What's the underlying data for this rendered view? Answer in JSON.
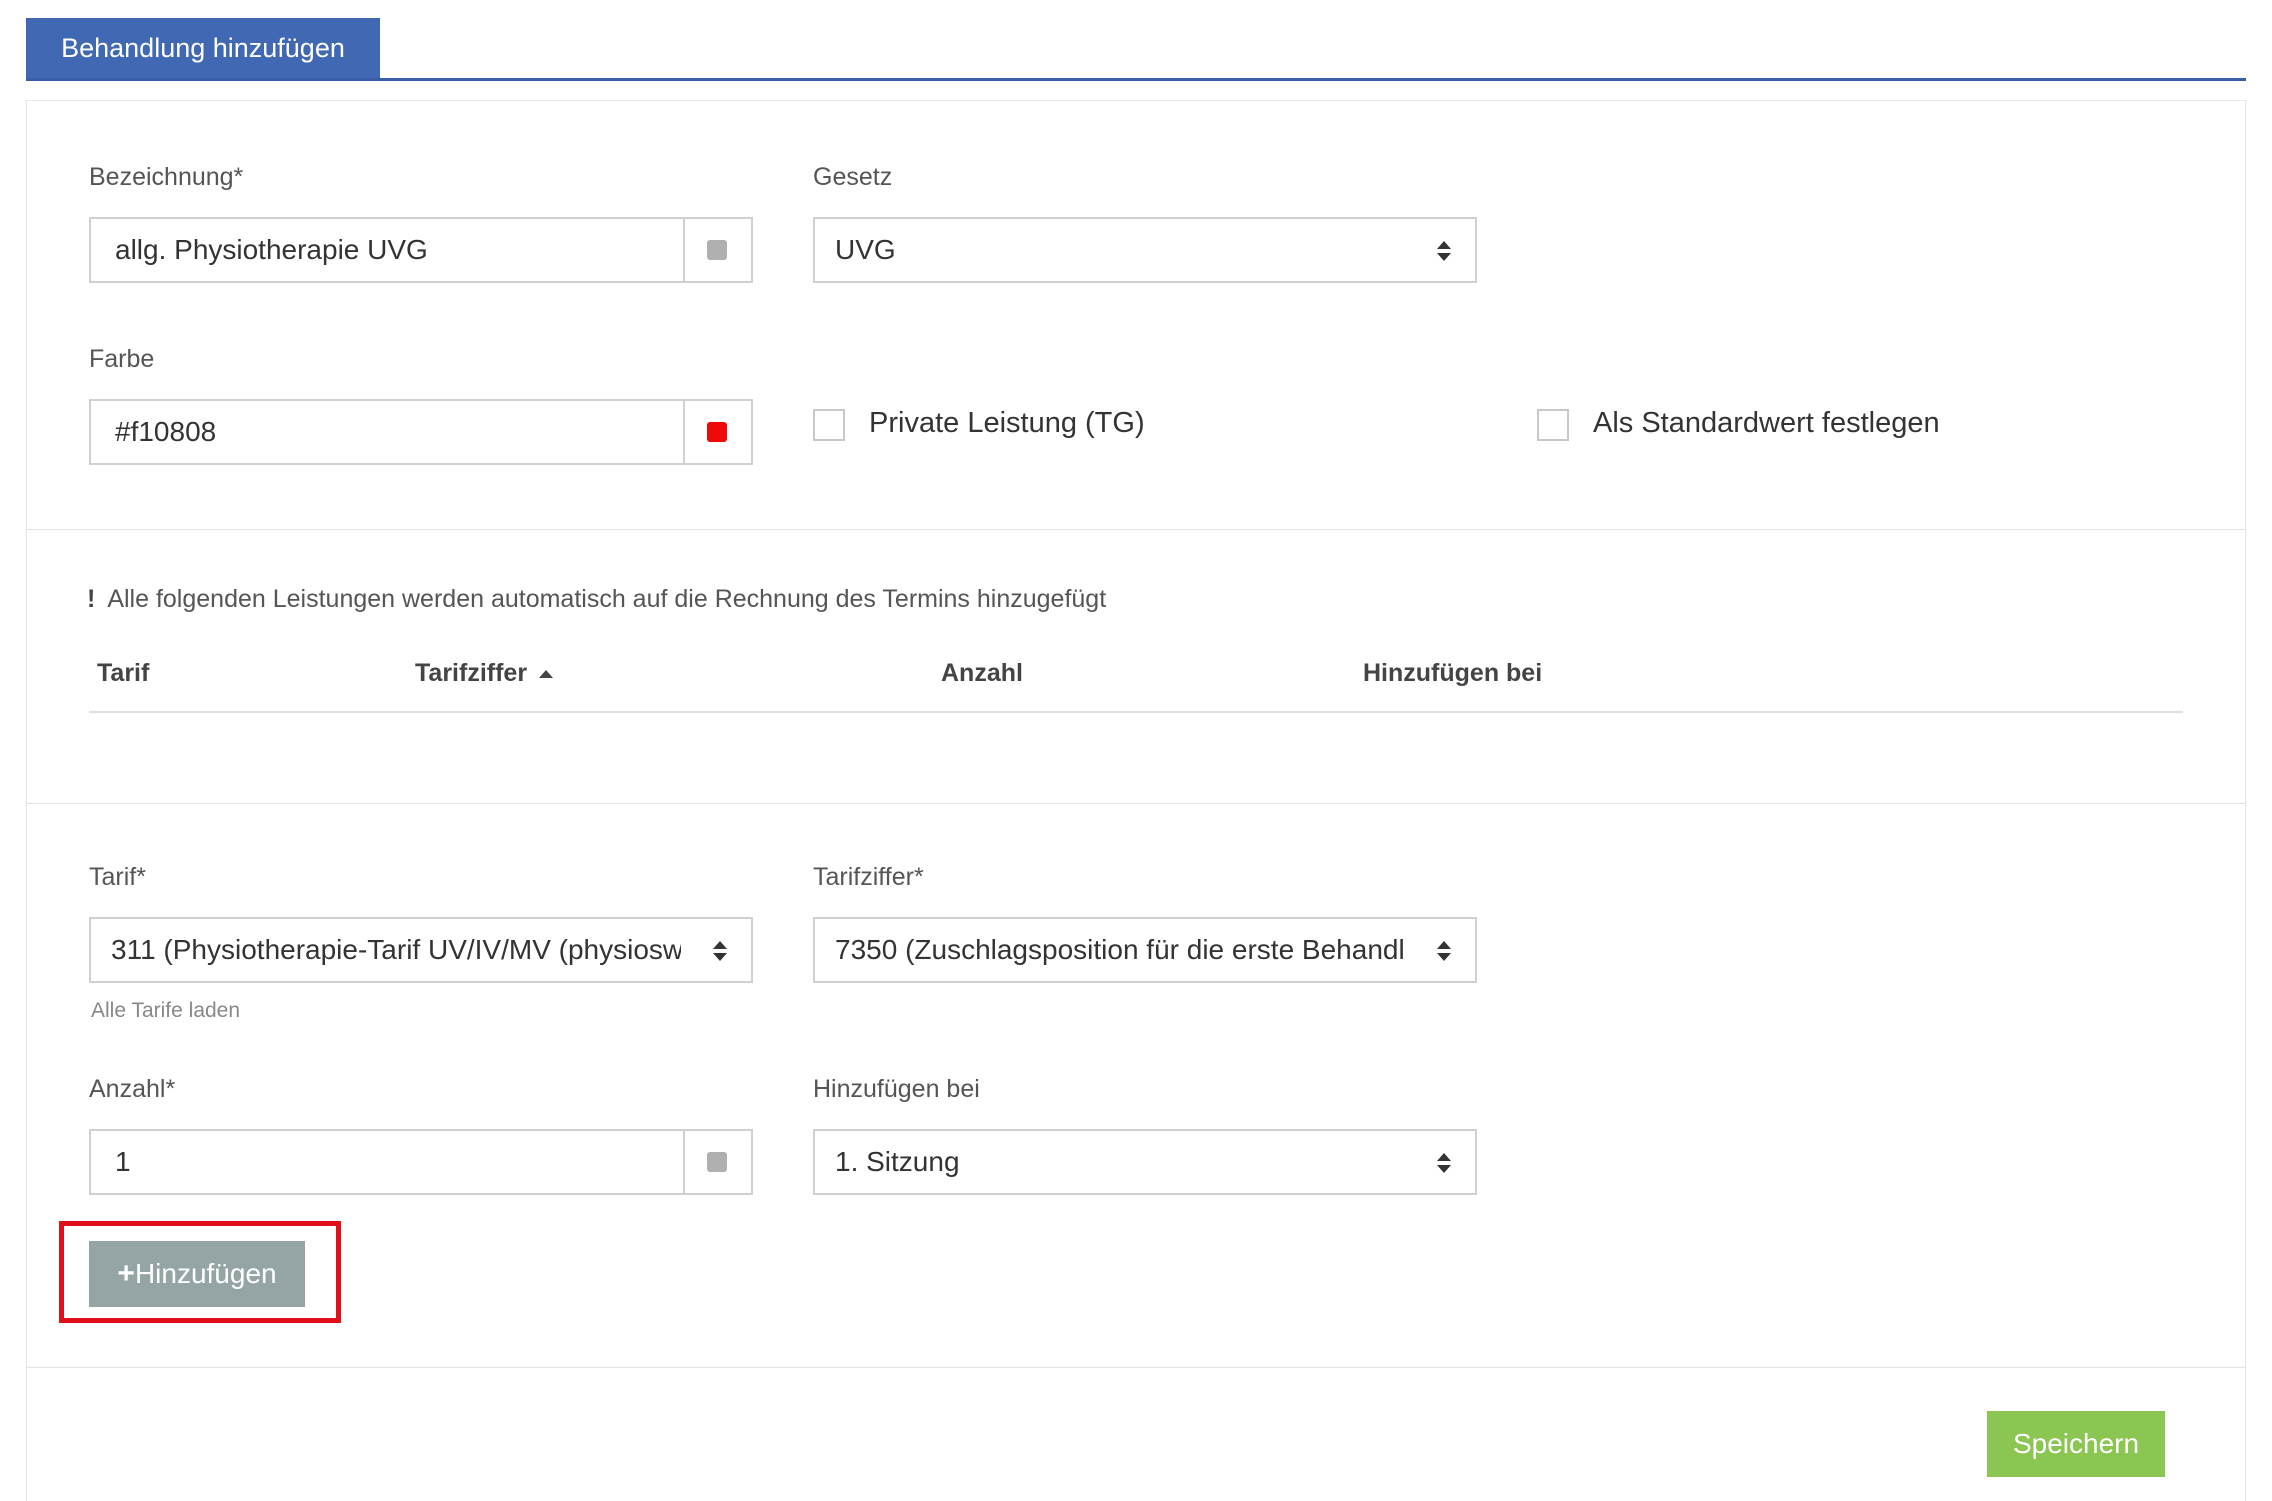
{
  "tab": {
    "label": "Behandlung hinzufügen"
  },
  "form": {
    "bezeichnung": {
      "label": "Bezeichnung*",
      "value": "allg. Physiotherapie UVG"
    },
    "gesetz": {
      "label": "Gesetz",
      "value": "UVG"
    },
    "farbe": {
      "label": "Farbe",
      "value": "#f10808",
      "swatch_color": "#f10808"
    },
    "private_leistung": {
      "label": "Private Leistung (TG)",
      "checked": false
    },
    "standardwert": {
      "label": "Als Standardwert festlegen",
      "checked": false
    }
  },
  "services": {
    "notice": "Alle folgenden Leistungen werden automatisch auf die Rechnung des Termins hinzugefügt",
    "columns": [
      "Tarif",
      "Tarifziffer",
      "Anzahl",
      "Hinzufügen bei"
    ],
    "rows": []
  },
  "add_service": {
    "tarif": {
      "label": "Tarif*",
      "value": "311 (Physiotherapie-Tarif UV/IV/MV (physiosw",
      "hint": "Alle Tarife laden"
    },
    "tarifziffer": {
      "label": "Tarifziffer*",
      "value": "7350 (Zuschlagsposition für die erste Behandl"
    },
    "anzahl": {
      "label": "Anzahl*",
      "value": "1"
    },
    "hinzufuegen_bei": {
      "label": "Hinzufügen bei",
      "value": "1. Sitzung"
    },
    "add_button": {
      "plus": "+",
      "label": "Hinzufügen"
    }
  },
  "footer": {
    "save_label": "Speichern"
  },
  "colors": {
    "tab_bg": "#4168b3",
    "add_button_bg": "#95a5a6",
    "save_button_bg": "#8bc653",
    "highlight_border": "#e0101b",
    "addon_swatch_gray": "#b0b0b0"
  }
}
